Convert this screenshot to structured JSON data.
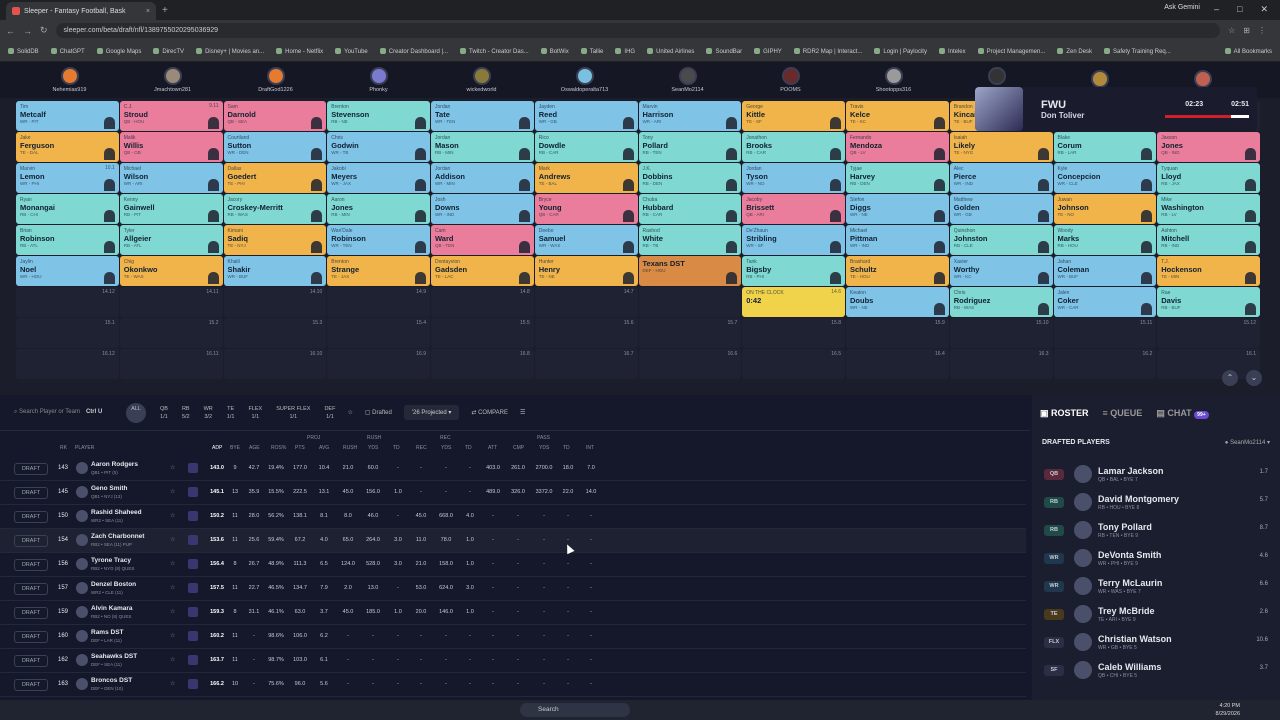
{
  "browser": {
    "tab_title": "Sleeper - Fantasy Football, Bask",
    "url": "sleeper.com/beta/draft/nfl/1389755020295036929",
    "ask": "Ask Gemini",
    "bookmarks": [
      "SolidDB",
      "ChatGPT",
      "Google Maps",
      "DirecTV",
      "Disney+ | Movies an...",
      "Home - Netflix",
      "YouTube",
      "Creator Dashboard |...",
      "Twitch - Creator Das...",
      "BotWix",
      "Tallie",
      "IHG",
      "United Airlines",
      "SoundBar",
      "GIPHY",
      "RDR2 Map | Interact...",
      "Login | Paylocity",
      "Intelex",
      "Project Managemen...",
      "Zen Desk",
      "Safety Training Req..."
    ],
    "all_bookmarks": "All Bookmarks"
  },
  "teams": [
    "Nehemias919",
    "Jmachtown281",
    "DraftGod1226",
    "Phonky",
    "wickedworld",
    "Oswaldoperalta713",
    "SeanMo2114",
    "POOMS",
    "Shootopps316",
    "AUTO",
    "",
    ""
  ],
  "fwu": {
    "title": "FWU",
    "player": "Don Toliver",
    "t1": "02:23",
    "t2": "02:51"
  },
  "board": [
    [
      {
        "f": "Tim",
        "l": "Metcalf",
        "p": "WR - PIT",
        "k": "",
        "c": "wr"
      },
      {
        "f": "C.J.",
        "l": "Stroud",
        "p": "QB - HOU",
        "k": "9.11",
        "c": "qb"
      },
      {
        "f": "Sam",
        "l": "Darnold",
        "p": "QB - SEA",
        "k": "",
        "c": "qb"
      },
      {
        "f": "Brenton",
        "l": "Stevenson",
        "p": "RB - NE",
        "k": "",
        "c": "rb"
      },
      {
        "f": "Jordan",
        "l": "Tate",
        "p": "WR - TEN",
        "k": "",
        "c": "wr"
      },
      {
        "f": "Jayden",
        "l": "Reed",
        "p": "WR - GB",
        "k": "",
        "c": "wr"
      },
      {
        "f": "Marvin",
        "l": "Harrison",
        "p": "WR - ARI",
        "k": "",
        "c": "wr"
      },
      {
        "f": "George",
        "l": "Kittle",
        "p": "TE - SF",
        "k": "",
        "c": "te"
      },
      {
        "f": "Travis",
        "l": "Kelce",
        "p": "TE - KC",
        "k": "",
        "c": "te"
      },
      {
        "f": "Brandon",
        "l": "Kincaid",
        "p": "TE - BUF",
        "k": "",
        "c": "te"
      },
      {
        "f": "",
        "l": "",
        "p": "",
        "k": "",
        "c": "empty"
      },
      {
        "f": "",
        "l": "",
        "p": "",
        "k": "",
        "c": "empty"
      }
    ],
    [
      {
        "f": "Jake",
        "l": "Ferguson",
        "p": "TE - DAL",
        "k": "",
        "c": "te"
      },
      {
        "f": "Malik",
        "l": "Willis",
        "p": "QB - GB",
        "k": "",
        "c": "qb"
      },
      {
        "f": "Courtland",
        "l": "Sutton",
        "p": "WR - DEN",
        "k": "",
        "c": "wr"
      },
      {
        "f": "Chris",
        "l": "Godwin",
        "p": "WR - TB",
        "k": "",
        "c": "wr"
      },
      {
        "f": "Jordan",
        "l": "Mason",
        "p": "RB - MIN",
        "k": "",
        "c": "rb"
      },
      {
        "f": "Rico",
        "l": "Dowdle",
        "p": "RB - CAR",
        "k": "",
        "c": "rb"
      },
      {
        "f": "Tony",
        "l": "Pollard",
        "p": "RB - TEN",
        "k": "",
        "c": "rb"
      },
      {
        "f": "Jonathon",
        "l": "Brooks",
        "p": "RB - CAR",
        "k": "",
        "c": "rb"
      },
      {
        "f": "Fernando",
        "l": "Mendoza",
        "p": "QB - LV",
        "k": "",
        "c": "qb"
      },
      {
        "f": "Isaiah",
        "l": "Likely",
        "p": "TE - NYG",
        "k": "",
        "c": "te"
      },
      {
        "f": "Blake",
        "l": "Corum",
        "p": "RB - LAR",
        "k": "",
        "c": "rb"
      },
      {
        "f": "Jaxson",
        "l": "Jones",
        "p": "QB - IND",
        "k": "",
        "c": "qb"
      }
    ],
    [
      {
        "f": "Marvin",
        "l": "Lemon",
        "p": "WR - PHI",
        "k": "10.1",
        "c": "wr"
      },
      {
        "f": "Michael",
        "l": "Wilson",
        "p": "WR - ARI",
        "k": "",
        "c": "wr"
      },
      {
        "f": "Dallas",
        "l": "Goedert",
        "p": "TE - PHI",
        "k": "",
        "c": "te"
      },
      {
        "f": "Jakobi",
        "l": "Meyers",
        "p": "WR - JAX",
        "k": "",
        "c": "wr"
      },
      {
        "f": "Jordan",
        "l": "Addison",
        "p": "WR - MIN",
        "k": "",
        "c": "wr"
      },
      {
        "f": "Mark",
        "l": "Andrews",
        "p": "TE - BAL",
        "k": "",
        "c": "te"
      },
      {
        "f": "J.K.",
        "l": "Dobbins",
        "p": "RB - DEN",
        "k": "",
        "c": "rb"
      },
      {
        "f": "Jordan",
        "l": "Tyson",
        "p": "WR - NO",
        "k": "",
        "c": "wr"
      },
      {
        "f": "Tyjae",
        "l": "Harvey",
        "p": "RB - DEN",
        "k": "",
        "c": "rb"
      },
      {
        "f": "Alec",
        "l": "Pierce",
        "p": "WR - IND",
        "k": "",
        "c": "wr"
      },
      {
        "f": "Kyle",
        "l": "Concepcion",
        "p": "WR - CLE",
        "k": "",
        "c": "wr"
      },
      {
        "f": "Tyquan",
        "l": "Lloyd",
        "p": "RB - JAX",
        "k": "",
        "c": "rb"
      }
    ],
    [
      {
        "f": "Ryan",
        "l": "Monangai",
        "p": "RB - CHI",
        "k": "",
        "c": "rb"
      },
      {
        "f": "Kenny",
        "l": "Gainwell",
        "p": "RB - PIT",
        "k": "",
        "c": "rb"
      },
      {
        "f": "Jacory",
        "l": "Croskey-Merritt",
        "p": "RB - WAS",
        "k": "",
        "c": "rb"
      },
      {
        "f": "Aaron",
        "l": "Jones",
        "p": "RB - MIN",
        "k": "",
        "c": "rb"
      },
      {
        "f": "Josh",
        "l": "Downs",
        "p": "WR - IND",
        "k": "",
        "c": "wr"
      },
      {
        "f": "Bryce",
        "l": "Young",
        "p": "QB - CAR",
        "k": "",
        "c": "qb"
      },
      {
        "f": "Chuba",
        "l": "Hubbard",
        "p": "RB - CAR",
        "k": "",
        "c": "rb"
      },
      {
        "f": "Jacoby",
        "l": "Brissett",
        "p": "QB - ARI",
        "k": "",
        "c": "qb"
      },
      {
        "f": "Stefon",
        "l": "Diggs",
        "p": "WR - NE",
        "k": "",
        "c": "wr"
      },
      {
        "f": "Matthew",
        "l": "Golden",
        "p": "WR - GB",
        "k": "",
        "c": "wr"
      },
      {
        "f": "Juwan",
        "l": "Johnson",
        "p": "TE - NO",
        "k": "",
        "c": "te"
      },
      {
        "f": "Mike",
        "l": "Washington",
        "p": "RB - LV",
        "k": "",
        "c": "rb"
      }
    ],
    [
      {
        "f": "Brian",
        "l": "Robinson",
        "p": "RB - ATL",
        "k": "",
        "c": "rb"
      },
      {
        "f": "Tyler",
        "l": "Allgeier",
        "p": "RB - ATL",
        "k": "",
        "c": "rb"
      },
      {
        "f": "Kimani",
        "l": "Sadiq",
        "p": "TE - NYJ",
        "k": "",
        "c": "te"
      },
      {
        "f": "Wan'Dale",
        "l": "Robinson",
        "p": "WR - TEN",
        "k": "",
        "c": "wr"
      },
      {
        "f": "Cam",
        "l": "Ward",
        "p": "QB - TEN",
        "k": "",
        "c": "qb"
      },
      {
        "f": "Deebo",
        "l": "Samuel",
        "p": "WR - WAS",
        "k": "",
        "c": "wr"
      },
      {
        "f": "Rashod",
        "l": "White",
        "p": "RB - TB",
        "k": "",
        "c": "rb"
      },
      {
        "f": "De'Zhaun",
        "l": "Stribling",
        "p": "WR - SF",
        "k": "",
        "c": "wr"
      },
      {
        "f": "Michael",
        "l": "Pittman",
        "p": "WR - IND",
        "k": "",
        "c": "wr"
      },
      {
        "f": "Quinshon",
        "l": "Johnston",
        "p": "RB - CLE",
        "k": "",
        "c": "rb"
      },
      {
        "f": "Woody",
        "l": "Marks",
        "p": "RB - HOU",
        "k": "",
        "c": "rb"
      },
      {
        "f": "Ashton",
        "l": "Mitchell",
        "p": "RB - IND",
        "k": "",
        "c": "rb"
      }
    ],
    [
      {
        "f": "Jaylin",
        "l": "Noel",
        "p": "WR - HOU",
        "k": "",
        "c": "wr"
      },
      {
        "f": "Chig",
        "l": "Okonkwo",
        "p": "TE - WAS",
        "k": "",
        "c": "te"
      },
      {
        "f": "Khalil",
        "l": "Shakir",
        "p": "WR - BUF",
        "k": "",
        "c": "wr"
      },
      {
        "f": "Brenton",
        "l": "Strange",
        "p": "TE - JAX",
        "k": "",
        "c": "te"
      },
      {
        "f": "Dontayvion",
        "l": "Gadsden",
        "p": "TE - LAC",
        "k": "",
        "c": "te"
      },
      {
        "f": "Hunter",
        "l": "Henry",
        "p": "TE - NE",
        "k": "",
        "c": "te"
      },
      {
        "f": "",
        "l": "Texans DST",
        "p": "DEF - HOU",
        "k": "",
        "c": "dst"
      },
      {
        "f": "Tank",
        "l": "Bigsby",
        "p": "RB - PHI",
        "k": "",
        "c": "rb"
      },
      {
        "f": "Brashard",
        "l": "Schultz",
        "p": "TE - HOU",
        "k": "",
        "c": "te"
      },
      {
        "f": "Xavier",
        "l": "Worthy",
        "p": "WR - KC",
        "k": "",
        "c": "wr"
      },
      {
        "f": "Jahan",
        "l": "Coleman",
        "p": "WR - BUF",
        "k": "",
        "c": "wr"
      },
      {
        "f": "T.J.",
        "l": "Hockenson",
        "p": "TE - MIN",
        "k": "",
        "c": "te"
      }
    ],
    [
      {
        "f": "",
        "l": "",
        "p": "",
        "k": "14.12",
        "c": "empty"
      },
      {
        "f": "",
        "l": "",
        "p": "",
        "k": "14.11",
        "c": "empty"
      },
      {
        "f": "",
        "l": "",
        "p": "",
        "k": "14.10",
        "c": "empty"
      },
      {
        "f": "",
        "l": "",
        "p": "",
        "k": "14.9",
        "c": "empty"
      },
      {
        "f": "",
        "l": "",
        "p": "",
        "k": "14.8",
        "c": "empty"
      },
      {
        "f": "",
        "l": "",
        "p": "",
        "k": "14.7",
        "c": "empty"
      },
      {
        "f": "",
        "l": "",
        "p": "",
        "k": "",
        "c": "empty"
      },
      {
        "f": "ON THE CLOCK",
        "l": "0:42",
        "p": "",
        "k": "14.6",
        "c": "otc"
      },
      {
        "f": "Keaton",
        "l": "Doubs",
        "p": "WR - NE",
        "k": "",
        "c": "wr"
      },
      {
        "f": "Chris",
        "l": "Rodriguez",
        "p": "RB - WAS",
        "k": "",
        "c": "rb"
      },
      {
        "f": "Jalen",
        "l": "Coker",
        "p": "WR - CAR",
        "k": "",
        "c": "wr"
      },
      {
        "f": "Rae",
        "l": "Davis",
        "p": "RB - BUF",
        "k": "",
        "c": "rb"
      }
    ],
    [
      {
        "f": "",
        "l": "",
        "p": "",
        "k": "15.1",
        "c": "empty"
      },
      {
        "f": "",
        "l": "",
        "p": "",
        "k": "15.2",
        "c": "empty"
      },
      {
        "f": "",
        "l": "",
        "p": "",
        "k": "15.3",
        "c": "empty"
      },
      {
        "f": "",
        "l": "",
        "p": "",
        "k": "15.4",
        "c": "empty"
      },
      {
        "f": "",
        "l": "",
        "p": "",
        "k": "15.5",
        "c": "empty"
      },
      {
        "f": "",
        "l": "",
        "p": "",
        "k": "15.6",
        "c": "empty"
      },
      {
        "f": "",
        "l": "",
        "p": "",
        "k": "15.7",
        "c": "empty"
      },
      {
        "f": "",
        "l": "",
        "p": "",
        "k": "15.8",
        "c": "empty"
      },
      {
        "f": "",
        "l": "",
        "p": "",
        "k": "15.9",
        "c": "empty"
      },
      {
        "f": "",
        "l": "",
        "p": "",
        "k": "15.10",
        "c": "empty"
      },
      {
        "f": "",
        "l": "",
        "p": "",
        "k": "15.11",
        "c": "empty"
      },
      {
        "f": "",
        "l": "",
        "p": "",
        "k": "15.12",
        "c": "empty"
      }
    ],
    [
      {
        "f": "",
        "l": "",
        "p": "",
        "k": "16.12",
        "c": "empty"
      },
      {
        "f": "",
        "l": "",
        "p": "",
        "k": "16.11",
        "c": "empty"
      },
      {
        "f": "",
        "l": "",
        "p": "",
        "k": "16.10",
        "c": "empty"
      },
      {
        "f": "",
        "l": "",
        "p": "",
        "k": "16.9",
        "c": "empty"
      },
      {
        "f": "",
        "l": "",
        "p": "",
        "k": "16.8",
        "c": "empty"
      },
      {
        "f": "",
        "l": "",
        "p": "",
        "k": "16.7",
        "c": "empty"
      },
      {
        "f": "",
        "l": "",
        "p": "",
        "k": "16.6",
        "c": "empty"
      },
      {
        "f": "",
        "l": "",
        "p": "",
        "k": "16.5",
        "c": "empty"
      },
      {
        "f": "",
        "l": "",
        "p": "",
        "k": "16.4",
        "c": "empty"
      },
      {
        "f": "",
        "l": "",
        "p": "",
        "k": "16.3",
        "c": "empty"
      },
      {
        "f": "",
        "l": "",
        "p": "",
        "k": "16.2",
        "c": "empty"
      },
      {
        "f": "",
        "l": "",
        "p": "",
        "k": "16.1",
        "c": "empty"
      }
    ]
  ],
  "filters": {
    "search": "Search Player or Team",
    "shortcut": "Ctrl U",
    "positions": [
      "ALL",
      "QB",
      "RB",
      "WR",
      "TE",
      "FLEX",
      "SUPER FLEX",
      "DEF"
    ],
    "counts": [
      "",
      "1/1",
      "5/2",
      "3/2",
      "1/1",
      "1/1",
      "1/1",
      "1/1"
    ],
    "drafted": "Drafted",
    "projected": "'26 Projected",
    "compare": "COMPARE"
  },
  "table_headers": {
    "rk": "RK",
    "player": "PLAYER",
    "proj": "PROJ",
    "rush": "RUSH",
    "rec": "REC",
    "pass": "PASS",
    "cols": [
      "ADP",
      "BYE",
      "AGE",
      "ROS%",
      "PTS",
      "AVG",
      "RUSH",
      "YDS",
      "TD",
      "REC",
      "YDS",
      "TD",
      "ATT",
      "CMP",
      "YDS",
      "TD",
      "INT"
    ]
  },
  "players": [
    {
      "rk": "143",
      "name": "Aaron Rodgers",
      "sub": "QB1 • PIT (5)",
      "v": [
        "143.0",
        "9",
        "42.7",
        "19.4%",
        "177.0",
        "10.4",
        "21.0",
        "60.0",
        "-",
        "-",
        "-",
        "-",
        "403.0",
        "261.0",
        "2700.0",
        "18.0",
        "7.0"
      ]
    },
    {
      "rk": "145",
      "name": "Geno Smith",
      "sub": "QB1 • NYJ (13)",
      "v": [
        "145.1",
        "13",
        "35.9",
        "15.5%",
        "222.5",
        "13.1",
        "45.0",
        "156.0",
        "1.0",
        "-",
        "-",
        "-",
        "489.0",
        "326.0",
        "3372.0",
        "22.0",
        "14.0"
      ]
    },
    {
      "rk": "150",
      "name": "Rashid Shaheed",
      "sub": "WR2 • SEA (11)",
      "v": [
        "150.2",
        "11",
        "28.0",
        "56.2%",
        "138.1",
        "8.1",
        "8.0",
        "46.0",
        "-",
        "45.0",
        "668.0",
        "4.0",
        "-",
        "-",
        "-",
        "-",
        "-"
      ]
    },
    {
      "rk": "154",
      "name": "Zach Charbonnet",
      "sub": "RB2 • SEA (11) PUP",
      "v": [
        "153.6",
        "11",
        "25.6",
        "59.4%",
        "67.2",
        "4.0",
        "65.0",
        "264.0",
        "3.0",
        "11.0",
        "78.0",
        "1.0",
        "-",
        "-",
        "-",
        "-",
        "-"
      ]
    },
    {
      "rk": "156",
      "name": "Tyrone Tracy",
      "sub": "RB2 • NYG (8) QUES",
      "v": [
        "156.4",
        "8",
        "26.7",
        "48.9%",
        "111.3",
        "6.5",
        "124.0",
        "528.0",
        "3.0",
        "21.0",
        "158.0",
        "1.0",
        "-",
        "-",
        "-",
        "-",
        "-"
      ]
    },
    {
      "rk": "157",
      "name": "Denzel Boston",
      "sub": "WR2 • CLE (11)",
      "v": [
        "157.5",
        "11",
        "22.7",
        "46.5%",
        "134.7",
        "7.9",
        "2.0",
        "13.0",
        "-",
        "53.0",
        "624.0",
        "3.0",
        "-",
        "-",
        "-",
        "-",
        "-"
      ]
    },
    {
      "rk": "159",
      "name": "Alvin Kamara",
      "sub": "RB2 • NO (8) QUES",
      "v": [
        "159.3",
        "8",
        "31.1",
        "46.1%",
        "63.0",
        "3.7",
        "45.0",
        "185.0",
        "1.0",
        "20.0",
        "146.0",
        "1.0",
        "-",
        "-",
        "-",
        "-",
        "-"
      ]
    },
    {
      "rk": "160",
      "name": "Rams DST",
      "sub": "DEF • LAR (11)",
      "v": [
        "160.2",
        "11",
        "-",
        "98.6%",
        "106.0",
        "6.2",
        "-",
        "-",
        "-",
        "-",
        "-",
        "-",
        "-",
        "-",
        "-",
        "-",
        "-"
      ]
    },
    {
      "rk": "162",
      "name": "Seahawks DST",
      "sub": "DEF • SEA (11)",
      "v": [
        "163.7",
        "11",
        "-",
        "98.7%",
        "103.0",
        "6.1",
        "-",
        "-",
        "-",
        "-",
        "-",
        "-",
        "-",
        "-",
        "-",
        "-",
        "-"
      ]
    },
    {
      "rk": "163",
      "name": "Broncos DST",
      "sub": "DEF • DEN (10)",
      "v": [
        "166.2",
        "10",
        "-",
        "75.6%",
        "96.0",
        "5.6",
        "-",
        "-",
        "-",
        "-",
        "-",
        "-",
        "-",
        "-",
        "-",
        "-",
        "-"
      ]
    }
  ],
  "draft_label": "DRAFT",
  "right": {
    "tabs": [
      "ROSTER",
      "QUEUE",
      "CHAT"
    ],
    "chat_badge": "99+",
    "header": "DRAFTED PLAYERS",
    "who": "SeanMo2114",
    "roster": [
      {
        "pos": "QB",
        "name": "Lamar Jackson",
        "sub": "QB • BAL • BYE 7",
        "rd": "1.7",
        "col": "#5a2a3c"
      },
      {
        "pos": "RB",
        "name": "David Montgomery",
        "sub": "RB • HOU • BYE 8",
        "rd": "5.7",
        "col": "#1f4a48"
      },
      {
        "pos": "RB",
        "name": "Tony Pollard",
        "sub": "RB • TEN • BYE 9",
        "rd": "8.7",
        "col": "#1f4a48"
      },
      {
        "pos": "WR",
        "name": "DeVonta Smith",
        "sub": "WR • PHI • BYE 9",
        "rd": "4.6",
        "col": "#20384e"
      },
      {
        "pos": "WR",
        "name": "Terry McLaurin",
        "sub": "WR • WAS • BYE 7",
        "rd": "6.6",
        "col": "#20384e"
      },
      {
        "pos": "TE",
        "name": "Trey McBride",
        "sub": "TE • ARI • BYE 9",
        "rd": "2.6",
        "col": "#4a3a1c"
      },
      {
        "pos": "FLX",
        "name": "Christian Watson",
        "sub": "WR • GB • BYE 5",
        "rd": "10.6",
        "col": "#2a2f45"
      },
      {
        "pos": "SF",
        "name": "Caleb Williams",
        "sub": "QB • CHI • BYE 5",
        "rd": "3.7",
        "col": "#2a2f45"
      }
    ]
  },
  "taskbar": {
    "search": "Search",
    "time": "4:20 PM",
    "date": "8/29/2026"
  }
}
